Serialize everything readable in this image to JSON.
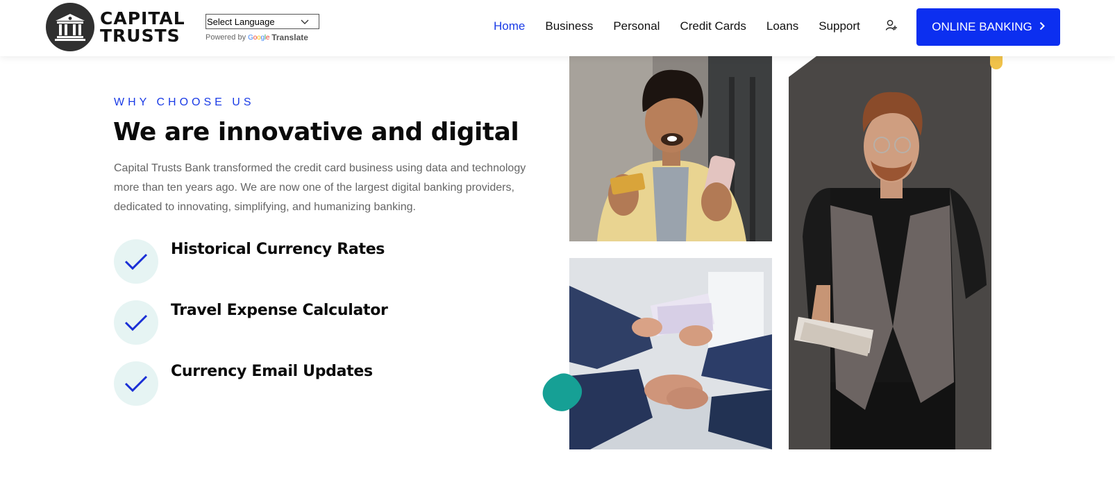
{
  "header": {
    "logo_line1": "CAPITAL",
    "logo_line2": "TRUSTS",
    "language_select": "Select Language",
    "powered_by": "Powered by",
    "google": "Google",
    "translate": "Translate",
    "nav": [
      {
        "label": "Home",
        "active": true
      },
      {
        "label": "Business",
        "active": false
      },
      {
        "label": "Personal",
        "active": false
      },
      {
        "label": "Credit Cards",
        "active": false
      },
      {
        "label": "Loans",
        "active": false
      },
      {
        "label": "Support",
        "active": false
      }
    ],
    "cta_label": "ONLINE BANKING",
    "icons": {
      "user": "user-plus-icon",
      "cta_arrow": "chevron-right-icon",
      "language_dropdown": "chevron-down-icon"
    }
  },
  "section": {
    "eyebrow": "WHY CHOOSE US",
    "headline": "We are innovative and digital",
    "description": "Capital Trusts Bank transformed the credit card business using data and technology more than ten years ago. We are now one of the largest digital banking providers, dedicated to innovating, simplifying, and humanizing banking.",
    "features": [
      {
        "title": "Historical Currency Rates",
        "icon": "check-icon"
      },
      {
        "title": "Travel Expense Calculator",
        "icon": "check-icon"
      },
      {
        "title": "Currency Email Updates",
        "icon": "check-icon"
      }
    ]
  },
  "images": [
    {
      "name": "man-with-card-and-phone-photo"
    },
    {
      "name": "handshake-with-cash-photo"
    },
    {
      "name": "man-in-vest-holding-cash-photo"
    }
  ],
  "colors": {
    "accent": "#1a3be6",
    "cta": "#0c2ff0",
    "check_bg": "#e6f4f3",
    "teal_blob": "#16a095",
    "yellow_blob": "#f0c24a"
  }
}
